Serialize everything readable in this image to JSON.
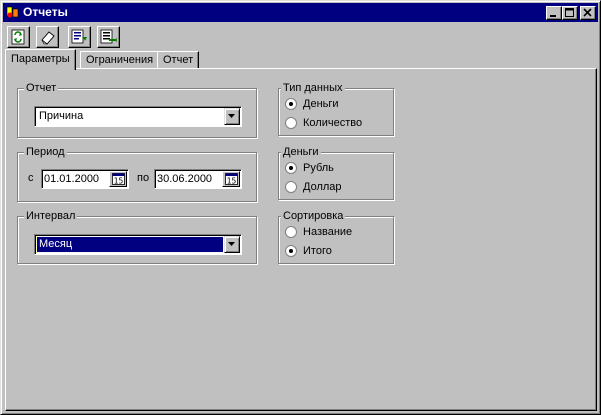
{
  "window": {
    "title": "Отчеты",
    "icon": "reports-app-icon"
  },
  "title_buttons": [
    "minimize-icon",
    "maximize-icon",
    "close-icon"
  ],
  "toolbar": {
    "buttons": [
      "refresh-icon",
      "eraser-icon",
      "report-icon",
      "export-icon"
    ]
  },
  "tabs": [
    {
      "label": "Параметры",
      "active": true
    },
    {
      "label": "Ограничения",
      "active": false
    },
    {
      "label": "Отчет",
      "active": false
    }
  ],
  "report_group": {
    "label": "Отчет",
    "selected": "Причина"
  },
  "period_group": {
    "label": "Период",
    "from_label": "с",
    "from_value": "01.01.2000",
    "to_label": "по",
    "to_value": "30.06.2000",
    "calendar_icon_text": "15"
  },
  "interval_group": {
    "label": "Интервал",
    "selected": "Месяц"
  },
  "data_type_group": {
    "label": "Тип данных",
    "options": [
      {
        "label": "Деньги",
        "checked": true
      },
      {
        "label": "Количество",
        "checked": false
      }
    ]
  },
  "money_group": {
    "label": "Деньги",
    "options": [
      {
        "label": "Рубль",
        "checked": true
      },
      {
        "label": "Доллар",
        "checked": false
      }
    ]
  },
  "sort_group": {
    "label": "Сортировка",
    "options": [
      {
        "label": "Название",
        "checked": false
      },
      {
        "label": "Итого",
        "checked": true
      }
    ]
  },
  "colors": {
    "face": "#c0c0c0",
    "titlebar": "#000080",
    "selection": "#000080"
  }
}
